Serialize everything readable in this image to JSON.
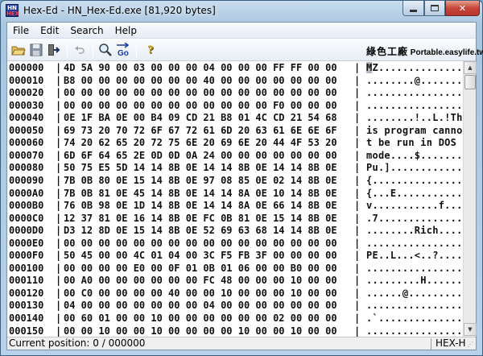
{
  "window": {
    "title": "Hex-Ed - HN_Hex-Ed.exe [81,920 bytes]",
    "icon_text_top": "HN",
    "icon_text_bottom": "HEX"
  },
  "menu": [
    "File",
    "Edit",
    "Search",
    "Help"
  ],
  "toolbar": {
    "buttons": [
      "open-folder-icon",
      "save-disk-icon",
      "exit-door-icon",
      "undo-icon",
      "find-magnifier-icon",
      "goto-icon",
      "help-icon"
    ],
    "goto_label": "Go",
    "help_glyph": "?"
  },
  "ad_banner": {
    "cjk_text": "綠色工廠",
    "latin_text": "Portable.easylife.tw"
  },
  "hex_rows": [
    {
      "addr": "000000",
      "bytes": "4D 5A 90 00 03 00 00 00 04 00 00 00 FF FF 00 00",
      "ascii": "MZ.............."
    },
    {
      "addr": "000010",
      "bytes": "B8 00 00 00 00 00 00 00 40 00 00 00 00 00 00 00",
      "ascii": "........@......."
    },
    {
      "addr": "000020",
      "bytes": "00 00 00 00 00 00 00 00 00 00 00 00 00 00 00 00",
      "ascii": "................"
    },
    {
      "addr": "000030",
      "bytes": "00 00 00 00 00 00 00 00 00 00 00 00 F0 00 00 00",
      "ascii": "................"
    },
    {
      "addr": "000040",
      "bytes": "0E 1F BA 0E 00 B4 09 CD 21 B8 01 4C CD 21 54 68",
      "ascii": "........!..L.!Th"
    },
    {
      "addr": "000050",
      "bytes": "69 73 20 70 72 6F 67 72 61 6D 20 63 61 6E 6E 6F",
      "ascii": "is program canno"
    },
    {
      "addr": "000060",
      "bytes": "74 20 62 65 20 72 75 6E 20 69 6E 20 44 4F 53 20",
      "ascii": "t be run in DOS "
    },
    {
      "addr": "000070",
      "bytes": "6D 6F 64 65 2E 0D 0D 0A 24 00 00 00 00 00 00 00",
      "ascii": "mode....$......."
    },
    {
      "addr": "000080",
      "bytes": "50 75 E5 5D 14 14 8B 0E 14 14 8B 0E 14 14 8B 0E",
      "ascii": "Pu.]............"
    },
    {
      "addr": "000090",
      "bytes": "7B 0B 80 0E 15 14 8B 0E 97 08 85 0E 02 14 8B 0E",
      "ascii": "{..............."
    },
    {
      "addr": "0000A0",
      "bytes": "7B 0B 81 0E 45 14 8B 0E 14 14 8A 0E 10 14 8B 0E",
      "ascii": "{...E..........."
    },
    {
      "addr": "0000B0",
      "bytes": "76 0B 98 0E 1D 14 8B 0E 14 14 8A 0E 66 14 8B 0E",
      "ascii": "v...........f..."
    },
    {
      "addr": "0000C0",
      "bytes": "12 37 81 0E 16 14 8B 0E FC 0B 81 0E 15 14 8B 0E",
      "ascii": ".7.............."
    },
    {
      "addr": "0000D0",
      "bytes": "D3 12 8D 0E 15 14 8B 0E 52 69 63 68 14 14 8B 0E",
      "ascii": "........Rich...."
    },
    {
      "addr": "0000E0",
      "bytes": "00 00 00 00 00 00 00 00 00 00 00 00 00 00 00 00",
      "ascii": "................"
    },
    {
      "addr": "0000F0",
      "bytes": "50 45 00 00 4C 01 04 00 3C F5 FB 3F 00 00 00 00",
      "ascii": "PE..L...<..?...."
    },
    {
      "addr": "000100",
      "bytes": "00 00 00 00 E0 00 0F 01 0B 01 06 00 00 B0 00 00",
      "ascii": "................"
    },
    {
      "addr": "000110",
      "bytes": "00 A0 00 00 00 00 00 00 FC 48 00 00 00 10 00 00",
      "ascii": ".........H......"
    },
    {
      "addr": "000120",
      "bytes": "00 C0 00 00 00 00 40 00 00 10 00 00 00 10 00 00",
      "ascii": "......@........."
    },
    {
      "addr": "000130",
      "bytes": "04 00 00 00 00 00 00 00 04 00 00 00 00 00 00 00",
      "ascii": "................"
    },
    {
      "addr": "000140",
      "bytes": "00 60 01 00 00 10 00 00 00 00 00 00 02 00 00 00",
      "ascii": ".`.............."
    },
    {
      "addr": "000150",
      "bytes": "00 00 10 00 00 10 00 00 00 00 10 00 00 10 00 00",
      "ascii": "................"
    }
  ],
  "separator": "|",
  "status": {
    "position_label": "Current position: 0 / 000000",
    "mode": "HEX-H"
  }
}
